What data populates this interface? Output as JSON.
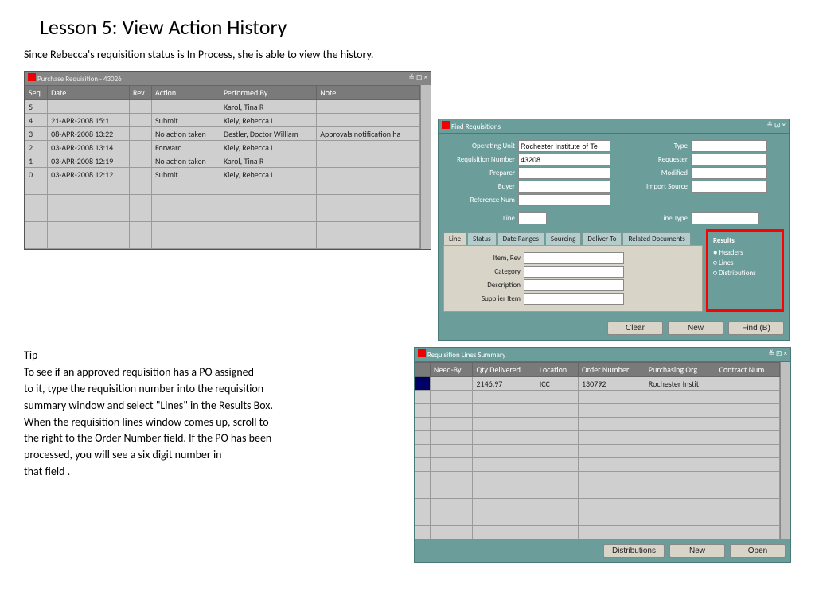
{
  "heading": "Lesson 5:  View Action History",
  "intro": "Since Rebecca's requisition status is In Process, she is able to view the history.",
  "tip_head": "Tip",
  "tip_lines": [
    "To see if an approved  requisition has a PO assigned",
    "to it, type the requisition number into the requisition",
    "summary window and select \"Lines\" in the Results Box.",
    "When the requisition lines window comes up, scroll to",
    "the right to the Order Number field. If the PO has been",
    "processed, you will see a six digit number in",
    "that field ."
  ],
  "history": {
    "title": "Purchase Requisition - 43026",
    "cols": [
      "Seq",
      "Date",
      "Rev",
      "Action",
      "Performed By",
      "Note"
    ],
    "rows": [
      [
        "5",
        "",
        "",
        "",
        "Karol, Tina R",
        ""
      ],
      [
        "4",
        "21-APR-2008 15:1",
        "",
        "Submit",
        "Kiely, Rebecca L",
        ""
      ],
      [
        "3",
        "08-APR-2008 13:22",
        "",
        "No action taken",
        "Destler, Doctor William",
        "Approvals notification ha"
      ],
      [
        "2",
        "03-APR-2008 13:14",
        "",
        "Forward",
        "Kiely, Rebecca L",
        ""
      ],
      [
        "1",
        "03-APR-2008 12:19",
        "",
        "No action taken",
        "Karol, Tina R",
        ""
      ],
      [
        "0",
        "03-APR-2008 12:12",
        "",
        "Submit",
        "Kiely, Rebecca L",
        ""
      ]
    ]
  },
  "find": {
    "title": "Find Requisitions",
    "left_labels": [
      "Operating Unit",
      "Requisition Number",
      "Preparer",
      "Buyer",
      "Reference Num"
    ],
    "left_values": [
      "Rochester Institute of Te",
      "43208",
      "",
      "",
      ""
    ],
    "right_labels": [
      "Type",
      "Requester",
      "Modified",
      "Import Source"
    ],
    "right_values": [
      "",
      "",
      "",
      ""
    ],
    "line_label": "Line",
    "line_value": "",
    "linetype_label": "Line Type",
    "linetype_value": "",
    "tabs": [
      "Line",
      "Status",
      "Date Ranges",
      "Sourcing",
      "Deliver To",
      "Related Documents"
    ],
    "tab_fields_labels": [
      "Item, Rev",
      "Category",
      "Description",
      "Supplier Item"
    ],
    "results_title": "Results",
    "results_opts": [
      "Headers",
      "Lines",
      "Distributions"
    ],
    "results_selected": 0,
    "buttons": [
      "Clear",
      "New",
      "Find (B)"
    ]
  },
  "summary": {
    "title": "Requisition Lines Summary",
    "cols": [
      "Need-By",
      "Qty Delivered",
      "Location",
      "Order Number",
      "Purchasing Org",
      "Contract Num"
    ],
    "rows": [
      [
        "",
        "2146.97",
        "ICC",
        "130792",
        "Rochester Instit",
        ""
      ]
    ],
    "buttons": [
      "Distributions",
      "New",
      "Open"
    ]
  }
}
